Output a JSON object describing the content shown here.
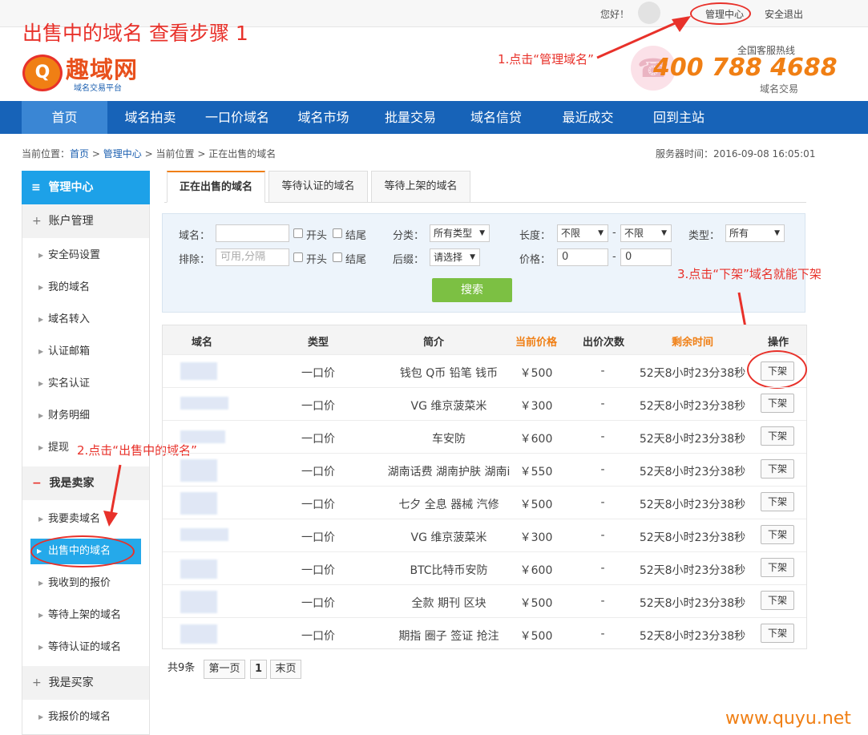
{
  "topbar": {
    "greeting": "您好！",
    "manage_link": "管理中心",
    "logout_link": "安全退出"
  },
  "title_annotation": "出售中的域名 查看步骤 1",
  "logo": {
    "mark": "Q",
    "name": "趣域网",
    "sub": "域名交易平台"
  },
  "hotline": {
    "label": "全国客服热线",
    "number": "400 788 4688",
    "sub": "域名交易"
  },
  "annotations": {
    "step1": "1.点击“管理域名”",
    "step2": "2.点击“出售中的域名”",
    "step3": "3.点击“下架”域名就能下架"
  },
  "nav": [
    "首页",
    "域名拍卖",
    "一口价域名",
    "域名市场",
    "批量交易",
    "域名信贷",
    "最近成交",
    "回到主站"
  ],
  "breadcrumb": {
    "prefix": "当前位置：",
    "home": "首页",
    "sep": ">",
    "manage": "管理中心",
    "pos": "当前位置",
    "current": "正在出售的域名"
  },
  "server_time": "服务器时间：2016-09-08 16:05:01",
  "sidebar": {
    "header": "管理中心",
    "account_section": "账户管理",
    "account_items": [
      "安全码设置",
      "我的域名",
      "域名转入",
      "认证邮箱",
      "实名认证",
      "财务明细",
      "提现"
    ],
    "seller_section": "我是卖家",
    "seller_items": [
      "我要卖域名",
      "出售中的域名",
      "我收到的报价",
      "等待上架的域名",
      "等待认证的域名"
    ],
    "buyer_section": "我是买家",
    "buyer_items": [
      "我报价的域名"
    ],
    "plus": "+",
    "minus": "−",
    "menu_icon": "≡"
  },
  "tabs": [
    "正在出售的域名",
    "等待认证的域名",
    "等待上架的域名"
  ],
  "filter": {
    "domain_label": "域名：",
    "exclude_label": "排除：",
    "exclude_placeholder": "可用,分隔",
    "start_label": "开头",
    "end_label": "结尾",
    "category_label": "分类：",
    "category_value": "所有类型",
    "suffix_label": "后缀：",
    "suffix_value": "请选择",
    "length_label": "长度：",
    "length_min": "不限",
    "length_max": "不限",
    "price_label": "价格：",
    "price_min": "0",
    "price_max": "0",
    "dash": "-",
    "type_label": "类型：",
    "type_value": "所有",
    "search_button": "搜索"
  },
  "table": {
    "headers": [
      "域名",
      "类型",
      "简介",
      "当前价格",
      "出价次数",
      "剩余时间",
      "操作"
    ],
    "rows": [
      {
        "type": "一口价",
        "intro": "钱包 Q币 铅笔 钱币",
        "price": "￥500",
        "bids": "-",
        "remaining": "52天8小时23分38秒",
        "action": "下架"
      },
      {
        "type": "一口价",
        "intro": "VG 维京菠菜米",
        "price": "￥300",
        "bids": "-",
        "remaining": "52天8小时23分38秒",
        "action": "下架"
      },
      {
        "type": "一口价",
        "intro": "车安防",
        "price": "￥600",
        "bids": "-",
        "remaining": "52天8小时23分38秒",
        "action": "下架"
      },
      {
        "type": "一口价",
        "intro": "湖南话费 湖南护肤 湖南i",
        "price": "￥550",
        "bids": "-",
        "remaining": "52天8小时23分38秒",
        "action": "下架"
      },
      {
        "type": "一口价",
        "intro": "七夕 全息 器械 汽修",
        "price": "￥500",
        "bids": "-",
        "remaining": "52天8小时23分38秒",
        "action": "下架"
      },
      {
        "type": "一口价",
        "intro": "VG 维京菠菜米",
        "price": "￥300",
        "bids": "-",
        "remaining": "52天8小时23分38秒",
        "action": "下架"
      },
      {
        "type": "一口价",
        "intro": "BTC比特币安防",
        "price": "￥600",
        "bids": "-",
        "remaining": "52天8小时23分38秒",
        "action": "下架"
      },
      {
        "type": "一口价",
        "intro": "全款 期刊 区块",
        "price": "￥500",
        "bids": "-",
        "remaining": "52天8小时23分38秒",
        "action": "下架"
      },
      {
        "type": "一口价",
        "intro": "期指 圈子 签证 抢注",
        "price": "￥500",
        "bids": "-",
        "remaining": "52天8小时23分38秒",
        "action": "下架"
      }
    ]
  },
  "pagination": {
    "total": "共9条",
    "first": "第一页",
    "current": "1",
    "last": "末页"
  },
  "watermark": "www.quyu.net",
  "colors": {
    "nav_bg": "#1763b8",
    "side_active": "#25a9ea",
    "accent_orange": "#f07f14",
    "annotation_red": "#e8312a",
    "search_green": "#7cc043"
  }
}
